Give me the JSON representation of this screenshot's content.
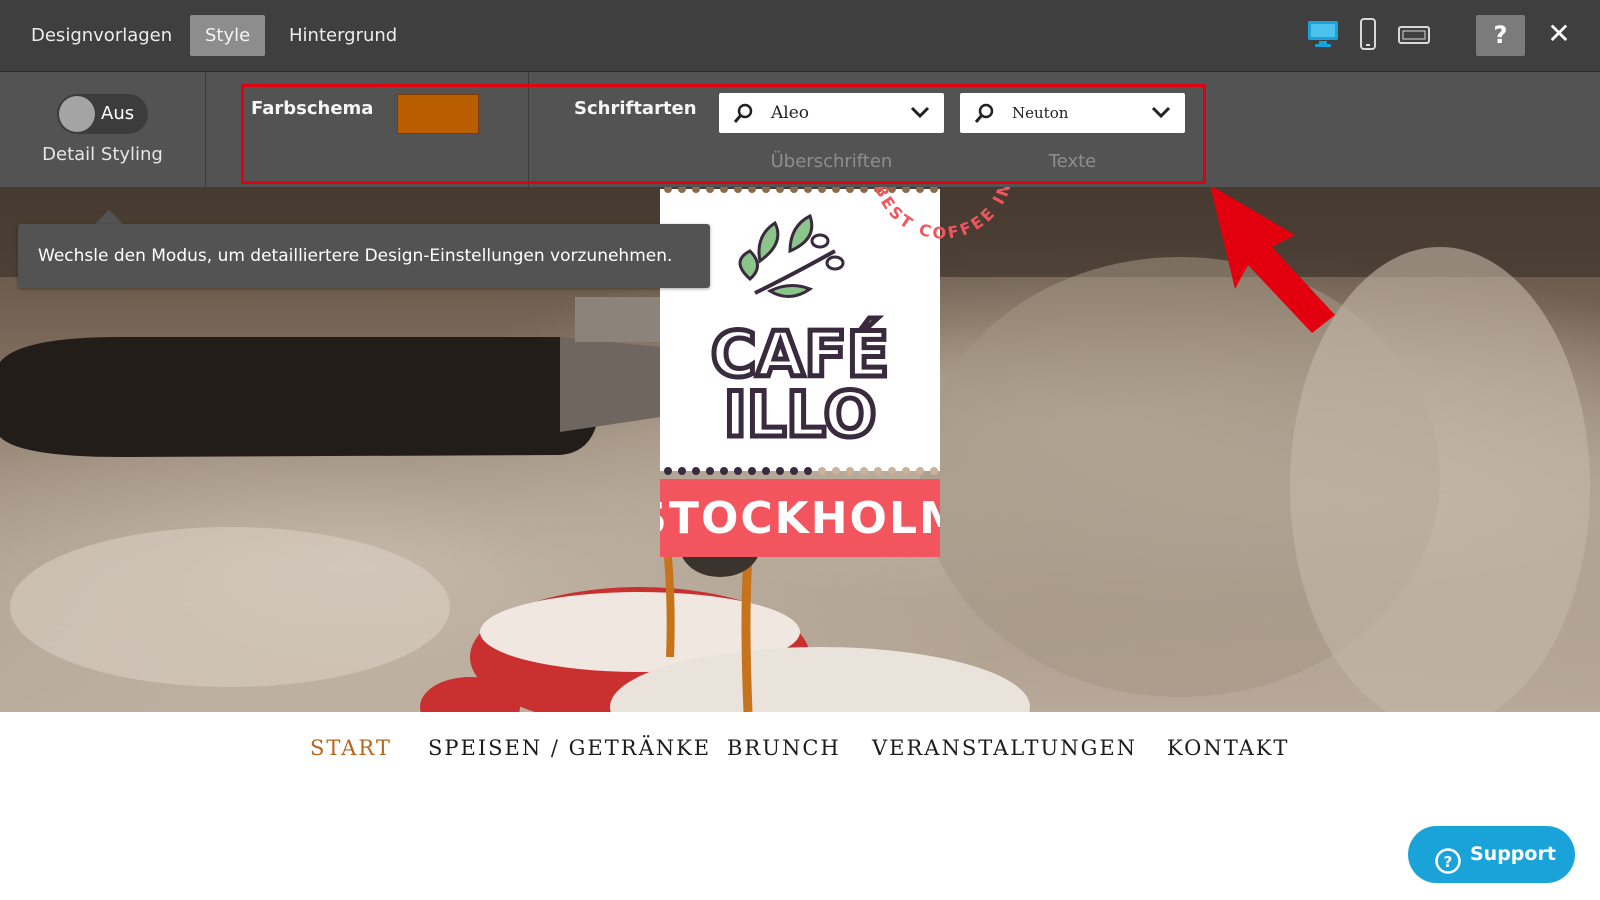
{
  "topbar": {
    "tabs": [
      {
        "label": "Designvorlagen"
      },
      {
        "label": "Style",
        "active": true
      },
      {
        "label": "Hintergrund"
      }
    ],
    "device_icons": [
      "desktop-icon",
      "phone-icon",
      "tablet-landscape-icon"
    ],
    "active_device": "desktop",
    "help_label": "?",
    "close_label": "✕"
  },
  "stylebar": {
    "toggle_label": "Aus",
    "detail_label": "Detail Styling",
    "color_scheme_label": "Farbschema",
    "color_scheme_value": "#b85d00",
    "fonts_label": "Schriftarten",
    "heading_font": "Aleo",
    "text_font": "Neuton",
    "heading_sub_label": "Überschriften",
    "text_sub_label": "Texte"
  },
  "tooltip": {
    "text": "Wechsle den Modus, um detailliertere Design-Einstellungen vorzunehmen."
  },
  "logo": {
    "line1": "CAFÉ",
    "line2": "ILLO",
    "banner": "STOCKHOLM",
    "badge_text": "BEST COFFEE IN TOWN · CAFE ILLO ·"
  },
  "nav": {
    "items": [
      {
        "label": "START",
        "active": true
      },
      {
        "label": "SPEISEN / GETRÄNKE"
      },
      {
        "label": "BRUNCH"
      },
      {
        "label": "VERANSTALTUNGEN"
      },
      {
        "label": "KONTAKT"
      }
    ]
  },
  "support": {
    "label": "Support"
  },
  "colors": {
    "accent_blue": "#1aa3d8",
    "nav_active": "#b5651d",
    "highlight_red": "#e2000f",
    "logo_pink": "#f2555d",
    "logo_dark": "#3a2a3d"
  }
}
